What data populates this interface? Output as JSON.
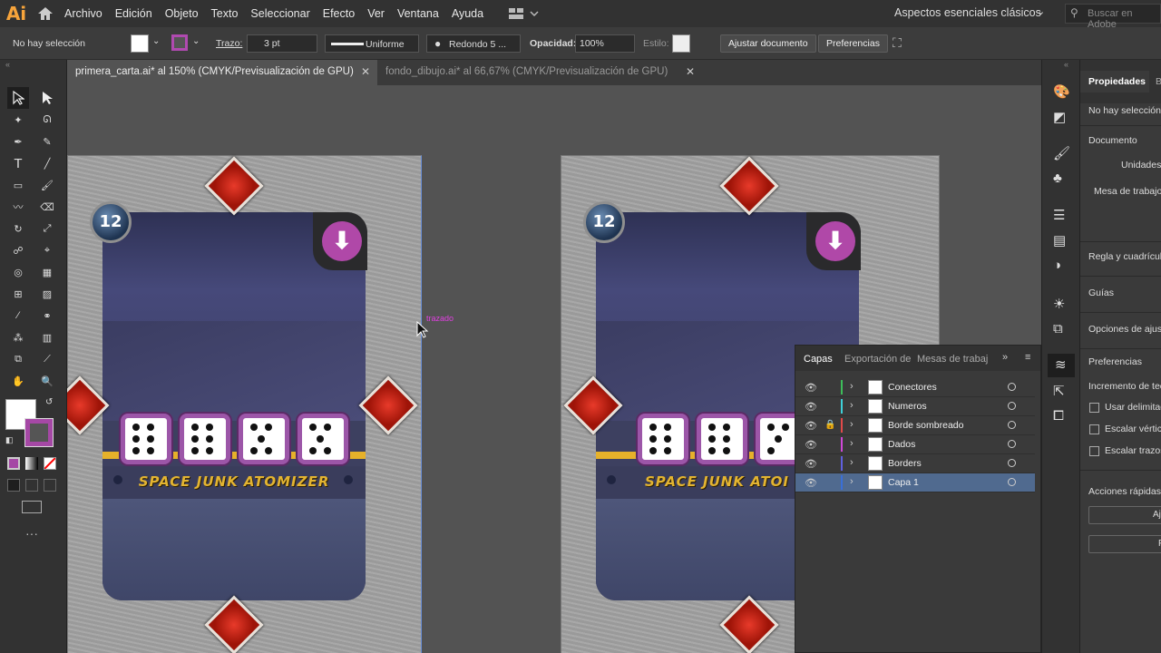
{
  "app": {
    "logo": "Ai"
  },
  "menu": [
    "Archivo",
    "Edición",
    "Objeto",
    "Texto",
    "Seleccionar",
    "Efecto",
    "Ver",
    "Ventana",
    "Ayuda"
  ],
  "workspace": "Aspectos esenciales clásicos",
  "search_placeholder": "Buscar en Adobe",
  "control": {
    "selection": "No hay selección",
    "stroke_label": "Trazo:",
    "stroke_value": "3 pt",
    "profile": "Uniforme",
    "brush": "Redondo 5 ...",
    "opacity_label": "Opacidad:",
    "opacity_value": "100%",
    "style_label": "Estilo:",
    "fit_btn": "Ajustar documento",
    "prefs_btn": "Preferencias"
  },
  "tabs": [
    {
      "label": "primera_carta.ai* al 150% (CMYK/Previsualización de GPU)",
      "active": true
    },
    {
      "label": "fondo_dibujo.ai* al 66,67% (CMYK/Previsualización de GPU)",
      "active": false
    }
  ],
  "canvas": {
    "smart_guide": "trazado",
    "card": {
      "badge": "12",
      "title": "SPACE JUNK ATOMIZER",
      "dice": [
        6,
        6,
        5,
        5
      ]
    },
    "card_right_title": "SPACE JUNK ATOI"
  },
  "layers_panel": {
    "tabs": [
      "Capas",
      "Exportación de",
      "Mesas de trabaj"
    ],
    "layers": [
      {
        "name": "Conectores",
        "color": "#3dbd5a",
        "locked": false,
        "selected": false
      },
      {
        "name": "Numeros",
        "color": "#3fd0d8",
        "locked": false,
        "selected": false
      },
      {
        "name": "Borde sombreado",
        "color": "#e14a4a",
        "locked": true,
        "selected": false
      },
      {
        "name": "Dados",
        "color": "#d048d8",
        "locked": false,
        "selected": false
      },
      {
        "name": "Borders",
        "color": "#6060e0",
        "locked": false,
        "selected": false
      },
      {
        "name": "Capa 1",
        "color": "#3a6fd8",
        "locked": false,
        "selected": true
      }
    ]
  },
  "properties": {
    "tabs": [
      "Propiedades",
      "B"
    ],
    "no_selection": "No hay selección",
    "document": "Documento",
    "units": "Unidades:",
    "artboard": "Mesa de trabajo:",
    "rulers": "Regla y cuadrícula",
    "guides": "Guías",
    "snap": "Opciones de ajuste",
    "preferences": "Preferencias",
    "increment": "Incremento de tec",
    "use_preview": "Usar delimitad",
    "scale_corners": "Escalar vértice",
    "scale_strokes": "Escalar trazos",
    "quick_actions": "Acciones rápidas",
    "quick_btn1": "Ajus",
    "quick_btn2": "P"
  }
}
